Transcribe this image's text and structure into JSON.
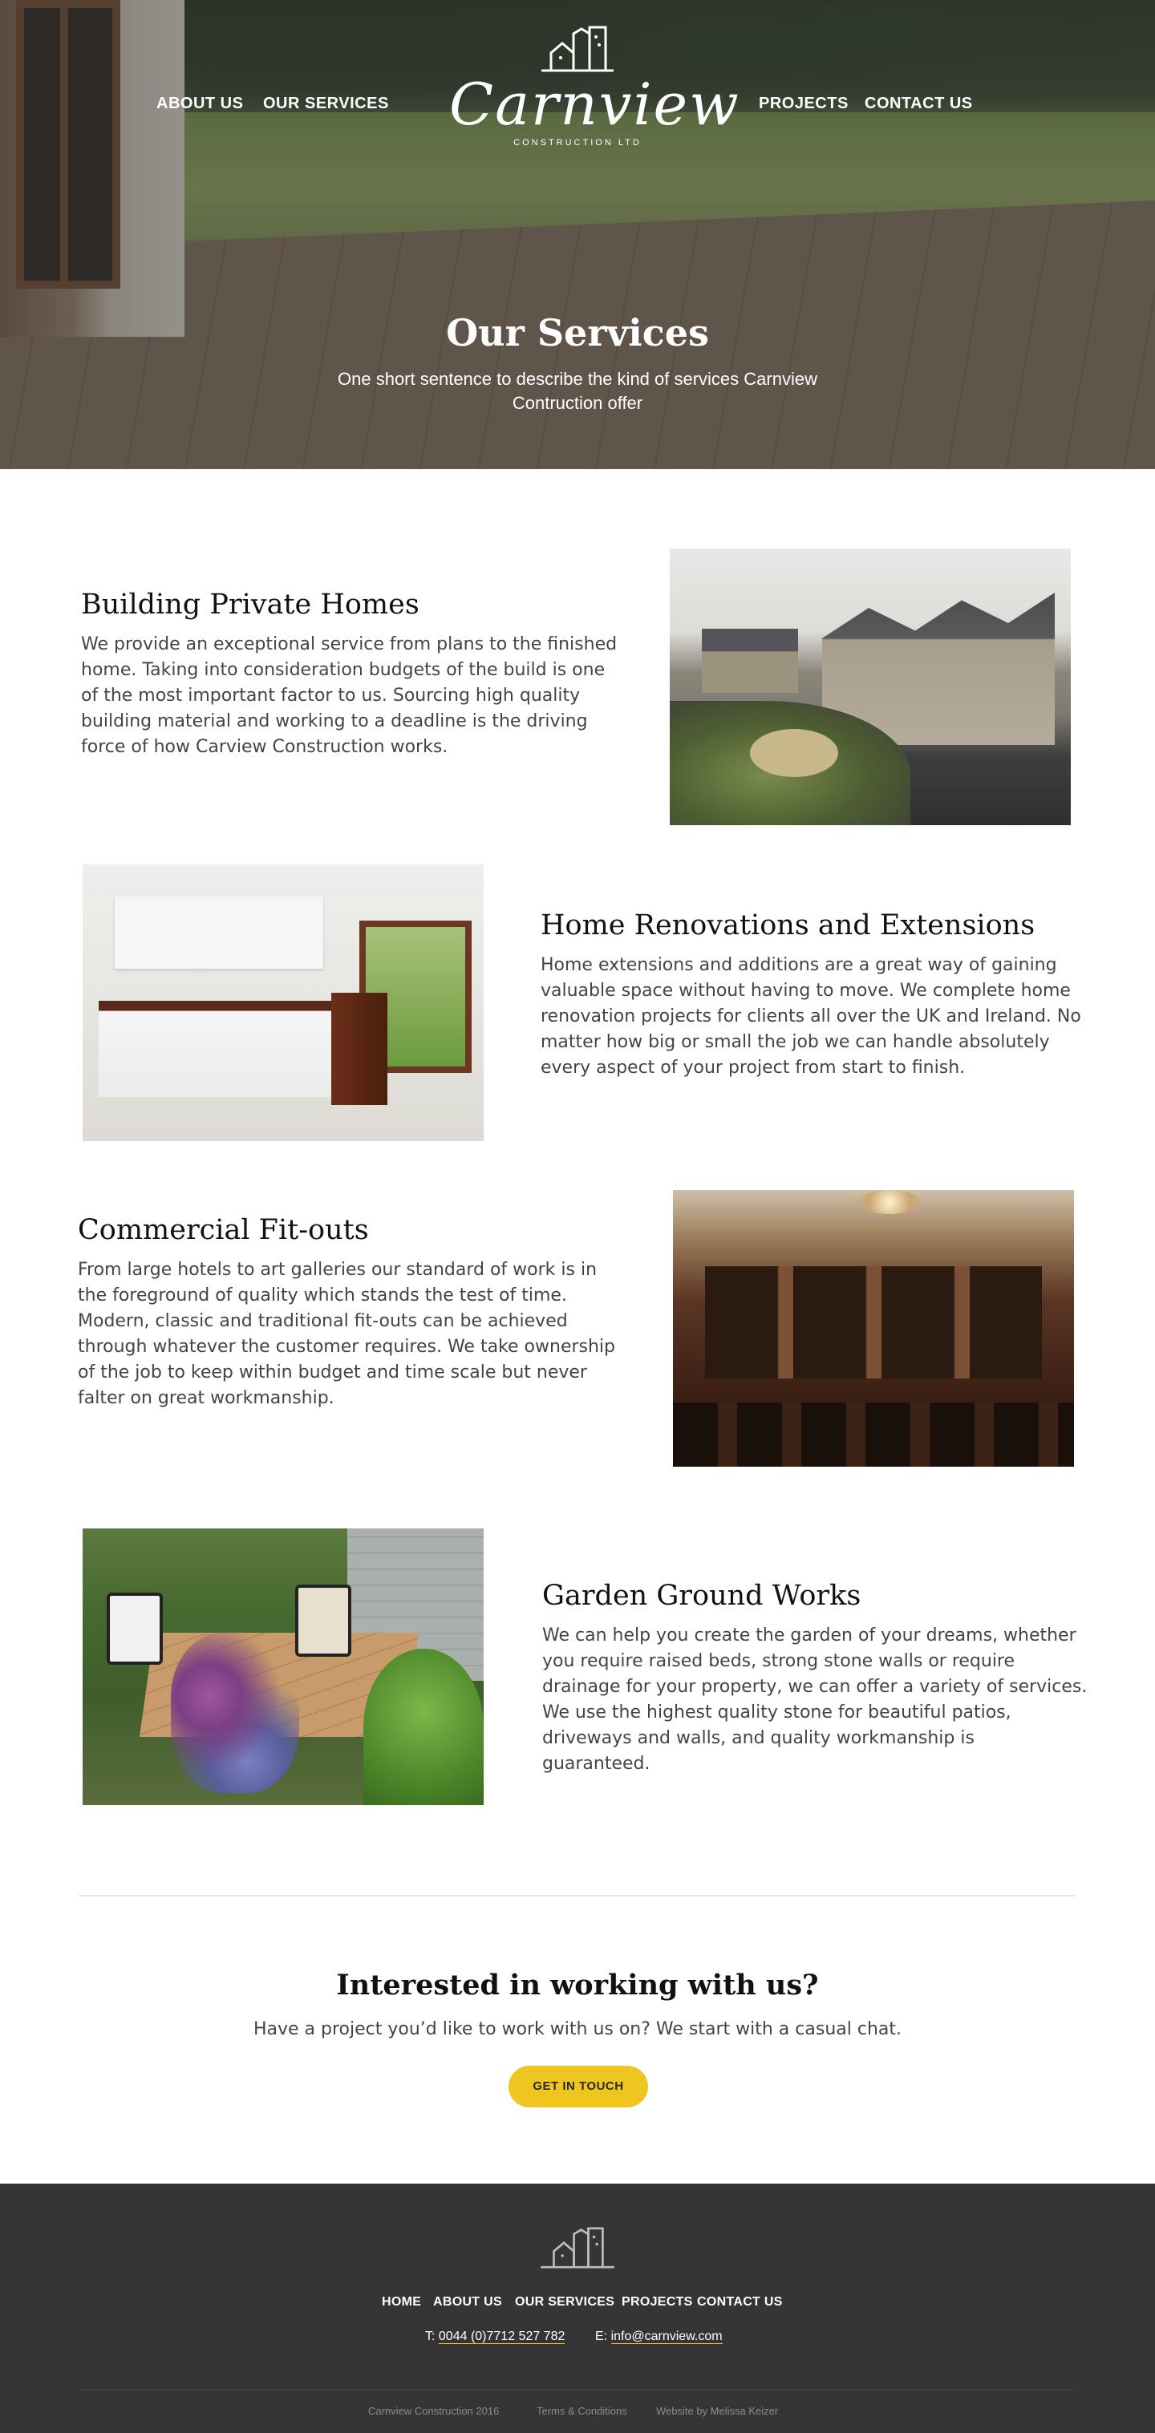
{
  "nav": {
    "about": "ABOUT US",
    "services": "OUR SERVICES",
    "projects": "PROJECTS",
    "contact": "CONTACT US"
  },
  "logo": {
    "script": "Carnview",
    "sub": "CONSTRUCTION LTD"
  },
  "hero": {
    "title": "Our Services",
    "subtitle": "One short sentence to describe the kind of services Carnview Contruction offer"
  },
  "services": [
    {
      "title": "Building Private Homes",
      "text": "We provide an exceptional service from plans to the finished home. Taking into consideration budgets of the build is one of the most important factor to us. Sourcing high quality building material and working to a deadline is the driving force of how Carview Construction works."
    },
    {
      "title": "Home Renovations and Extensions",
      "text": "Home extensions and additions are a great way of gaining valuable space without having to move. We complete home renovation projects for clients all over the UK and Ireland. No matter how big or small the job we can handle absolutely every aspect of your project from start to finish."
    },
    {
      "title": "Commercial Fit-outs",
      "text": "From large hotels to art galleries our standard of work is in the foreground of quality which stands the test of time. Modern, classic and traditional fit-outs can be achieved through whatever the customer requires. We take ownership of the job to keep within budget and time scale but never falter on great workmanship."
    },
    {
      "title": "Garden Ground Works",
      "text": "We can help you create the garden of your dreams, whether you require raised beds, strong stone walls or require drainage for your property, we can offer a variety of services. We use the highest quality stone for beautiful patios, driveways and walls, and quality workmanship is guaranteed."
    }
  ],
  "cta": {
    "title": "Interested in working with us?",
    "subtitle": "Have a project you’d like to work with us on? We start with a casual chat.",
    "button": "GET IN TOUCH"
  },
  "footer": {
    "nav": [
      "HOME",
      "ABOUT US",
      "OUR SERVICES",
      "PROJECTS",
      "CONTACT US"
    ],
    "phone_label": "T:",
    "phone": "0044 (0)7712 527 782",
    "email_label": "E:",
    "email": "info@carnview.com",
    "copyright": "Carnview Construction 2016",
    "terms": "Terms & Conditions",
    "credit": "Website by Melissa Keizer"
  },
  "colors": {
    "accent": "#efc61f",
    "footer_bg": "#353535",
    "heading": "#111111",
    "body": "#444444"
  },
  "icons": [
    "house-logo-icon"
  ]
}
